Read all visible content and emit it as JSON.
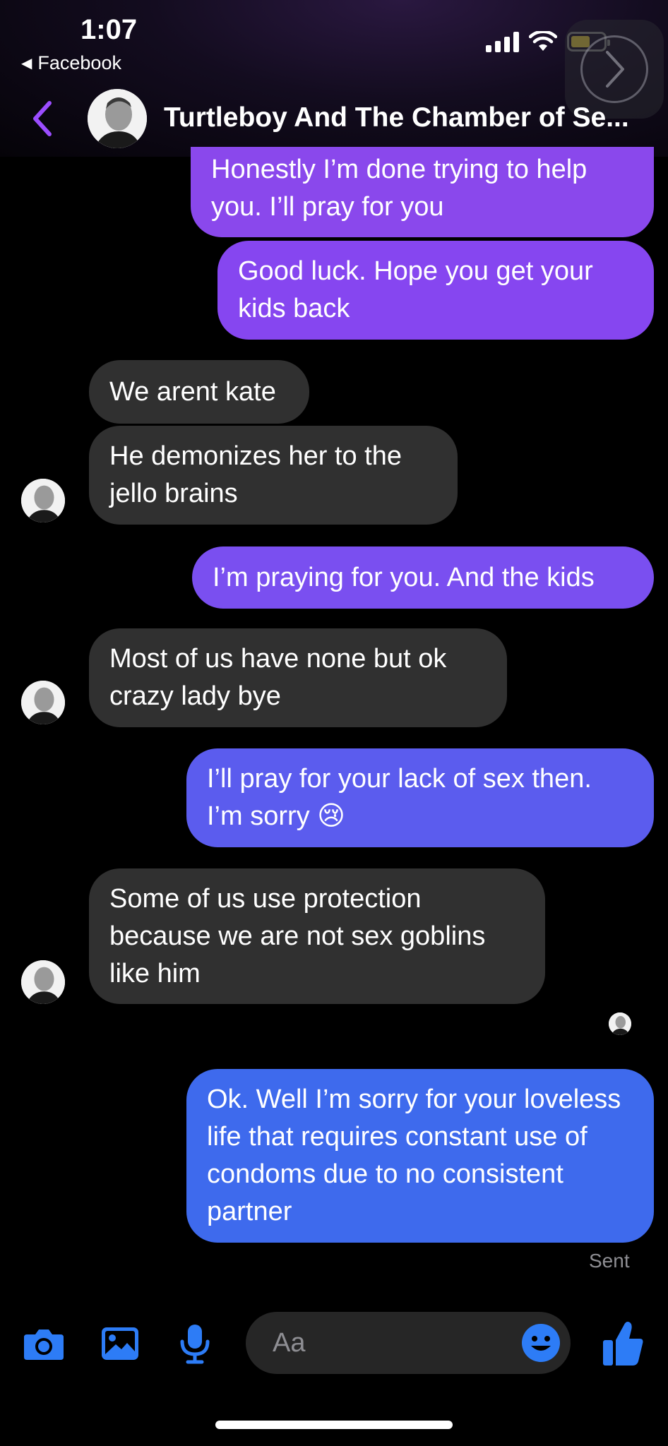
{
  "status_bar": {
    "time": "1:07",
    "back_app": "Facebook"
  },
  "header": {
    "title": "Turtleboy And The Chamber of Se..."
  },
  "messages": [
    {
      "side": "sent",
      "text": "Honestly I’m done trying to help you. I’ll pray for you",
      "color": "#8a48ec"
    },
    {
      "side": "sent",
      "text": "Good luck. Hope you get your kids back",
      "color": "#8646f0"
    },
    {
      "side": "received",
      "text": "We arent kate"
    },
    {
      "side": "received",
      "text": "He demonizes her to the jello brains"
    },
    {
      "side": "sent",
      "text": "I’m praying for you. And the kids",
      "color": "#7a4ff0"
    },
    {
      "side": "received",
      "text": "Most of us have none but ok crazy lady bye"
    },
    {
      "side": "sent",
      "text": "I’ll pray for your lack of sex then. I’m sorry 😢",
      "color": "#5b5cee"
    },
    {
      "side": "received",
      "text": "Some of us use protection because we are not sex goblins like him"
    },
    {
      "side": "sent",
      "text": "Ok. Well I’m sorry for your loveless life that requires constant use of condoms due to no consistent partner",
      "color": "#3e6aed"
    }
  ],
  "sent_status": "Sent",
  "composer": {
    "placeholder": "Aa",
    "icons": [
      "camera-icon",
      "gallery-icon",
      "microphone-icon",
      "emoji-icon",
      "thumbs-up-icon"
    ],
    "accent": "#2d7cf6"
  }
}
